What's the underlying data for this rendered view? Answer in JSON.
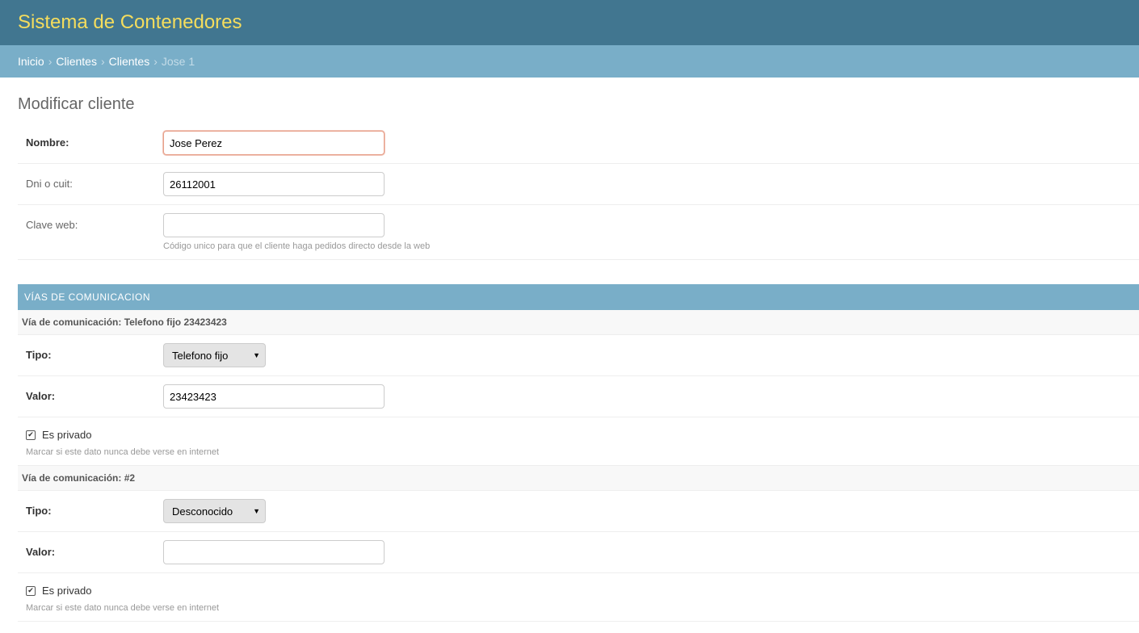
{
  "header": {
    "title": "Sistema de Contenedores"
  },
  "breadcrumbs": {
    "home": "Inicio",
    "app": "Clientes",
    "model": "Clientes",
    "current": "Jose 1",
    "separator": "›"
  },
  "page": {
    "title": "Modificar cliente"
  },
  "form": {
    "nombre": {
      "label": "Nombre:",
      "value": "Jose Perez"
    },
    "dni": {
      "label": "Dni o cuit:",
      "value": "26112001"
    },
    "clave": {
      "label": "Clave web:",
      "value": "",
      "help": "Código unico para que el cliente haga pedidos directo desde la web"
    }
  },
  "inline": {
    "caption": "VÍAS DE COMUNICACION",
    "items": [
      {
        "header": "Vía de comunicación: Telefono fijo 23423423",
        "tipo_label": "Tipo:",
        "tipo_value": "Telefono fijo",
        "valor_label": "Valor:",
        "valor_value": "23423423",
        "privado_label": "Es privado",
        "privado_checked": true,
        "privado_help": "Marcar si este dato nunca debe verse en internet"
      },
      {
        "header": "Vía de comunicación: #2",
        "tipo_label": "Tipo:",
        "tipo_value": "Desconocido",
        "valor_label": "Valor:",
        "valor_value": "",
        "privado_label": "Es privado",
        "privado_checked": true,
        "privado_help": "Marcar si este dato nunca debe verse en internet"
      }
    ]
  },
  "icons": {
    "checkmark": "✔",
    "dropdown_arrow": "▼"
  },
  "colors": {
    "header_bg": "#417690",
    "title": "#f5dd5d",
    "breadcrumb_bg": "#79aec8"
  }
}
